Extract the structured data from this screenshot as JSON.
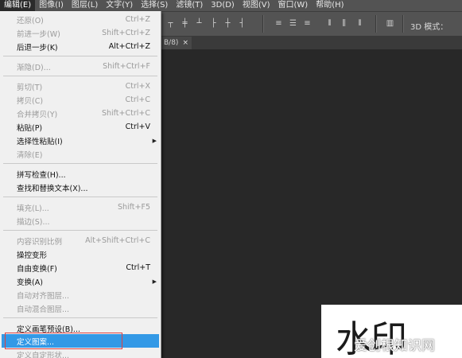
{
  "menubar": {
    "items": [
      "编辑(E)",
      "图像(I)",
      "图层(L)",
      "文字(Y)",
      "选择(S)",
      "滤镜(T)",
      "3D(D)",
      "视图(V)",
      "窗口(W)",
      "帮助(H)"
    ]
  },
  "options": {
    "mode_label": "3D 模式："
  },
  "document": {
    "tab_title": "B/8)",
    "close": "×"
  },
  "canvas": {
    "calligraphy_text": "水印",
    "watermark_text": "爱创根知识网"
  },
  "menu": {
    "undo": {
      "label": "还原(O)",
      "shortcut": "Ctrl+Z"
    },
    "step_forward": {
      "label": "前进一步(W)",
      "shortcut": "Shift+Ctrl+Z"
    },
    "step_backward": {
      "label": "后退一步(K)",
      "shortcut": "Alt+Ctrl+Z"
    },
    "fade": {
      "label": "渐隐(D)...",
      "shortcut": "Shift+Ctrl+F"
    },
    "cut": {
      "label": "剪切(T)",
      "shortcut": "Ctrl+X"
    },
    "copy": {
      "label": "拷贝(C)",
      "shortcut": "Ctrl+C"
    },
    "copy_merged": {
      "label": "合并拷贝(Y)",
      "shortcut": "Shift+Ctrl+C"
    },
    "paste": {
      "label": "粘贴(P)",
      "shortcut": "Ctrl+V"
    },
    "paste_special": {
      "label": "选择性粘贴(I)"
    },
    "clear": {
      "label": "清除(E)"
    },
    "check_spelling": {
      "label": "拼写检查(H)..."
    },
    "find_replace": {
      "label": "查找和替换文本(X)..."
    },
    "fill": {
      "label": "填充(L)...",
      "shortcut": "Shift+F5"
    },
    "stroke": {
      "label": "描边(S)..."
    },
    "content_aware_scale": {
      "label": "内容识别比例",
      "shortcut": "Alt+Shift+Ctrl+C"
    },
    "puppet_warp": {
      "label": "操控变形"
    },
    "free_transform": {
      "label": "自由变换(F)",
      "shortcut": "Ctrl+T"
    },
    "transform": {
      "label": "变换(A)"
    },
    "auto_align": {
      "label": "自动对齐图层..."
    },
    "auto_blend": {
      "label": "自动混合图层..."
    },
    "define_brush": {
      "label": "定义画笔预设(B)..."
    },
    "define_pattern": {
      "label": "定义图案..."
    },
    "define_shape": {
      "label": "定义自定形状..."
    }
  }
}
